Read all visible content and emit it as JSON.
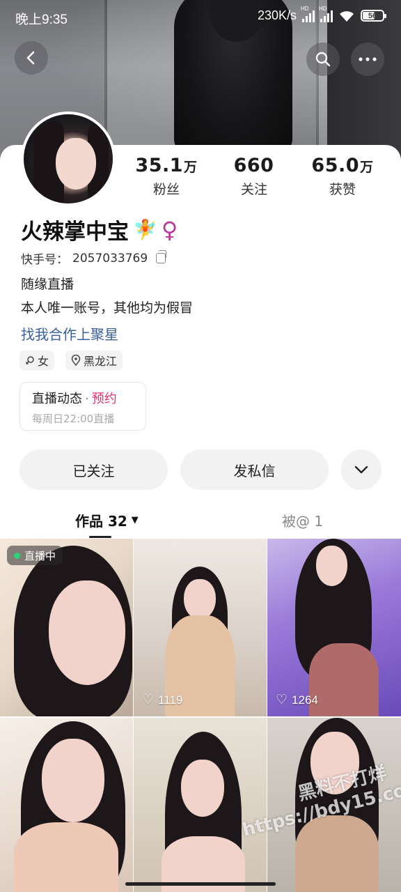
{
  "status_bar": {
    "time": "晚上9:35",
    "net_speed": "230K/s",
    "hd1": "HD",
    "hd2": "HD",
    "battery": "56"
  },
  "profile": {
    "name": "火辣掌中宝",
    "name_emoji": "🧚",
    "gender_symbol": "♀",
    "kuaishou_id_label": "快手号：",
    "kuaishou_id": "2057033769",
    "bio_line1": "随缘直播",
    "bio_line2": "本人唯一账号，其他均为假冒",
    "coop_link": "找我合作上聚星",
    "tags": {
      "gender": "女",
      "location": "黑龙江"
    }
  },
  "stats": {
    "fans": {
      "value": "35.1",
      "unit": "万",
      "label": "粉丝"
    },
    "following": {
      "value": "660",
      "unit": "",
      "label": "关注"
    },
    "likes": {
      "value": "65.0",
      "unit": "万",
      "label": "获赞"
    }
  },
  "live_card": {
    "title": "直播动态",
    "separator": "·",
    "action": "预约",
    "schedule": "每周日22:00直播"
  },
  "actions": {
    "followed": "已关注",
    "message": "发私信"
  },
  "tabs": {
    "works": "作品 32",
    "mentions": "被@ 1"
  },
  "grid": {
    "live_badge": "直播中",
    "tiles": [
      {
        "likes": ""
      },
      {
        "likes": "1119"
      },
      {
        "likes": "1264"
      },
      {
        "likes": ""
      },
      {
        "likes": ""
      },
      {
        "likes": ""
      }
    ]
  },
  "watermark": {
    "line1": "黑料不打烊",
    "line2": "https://bdy15.co"
  },
  "icons": [
    "back-icon",
    "search-icon",
    "more-icon",
    "copy-icon",
    "location-pin-icon",
    "gender-icon",
    "chevron-down-icon",
    "heart-icon"
  ]
}
